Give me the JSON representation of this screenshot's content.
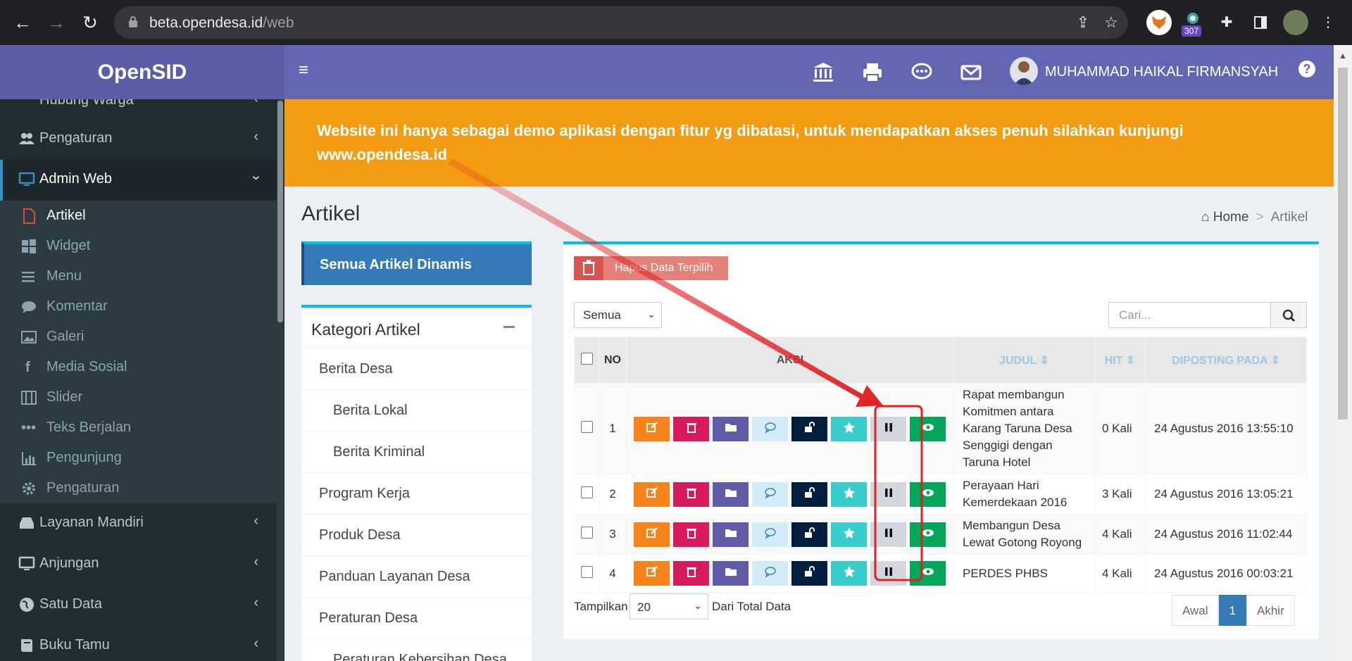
{
  "browser": {
    "url_host": "beta.opendesa.id",
    "url_path": "/web",
    "ext_badge": "307"
  },
  "app": {
    "logo": "OpenSID",
    "user_name": "MUHAMMAD HAIKAL FIRMANSYAH",
    "help": "?"
  },
  "sidebar": {
    "items": [
      {
        "label": "Hubung Warga",
        "icon": "comments-icon"
      },
      {
        "label": "Pengaturan",
        "icon": "users-icon"
      },
      {
        "label": "Admin Web",
        "icon": "monitor-icon"
      },
      {
        "label": "Layanan Mandiri",
        "icon": "inbox-icon"
      },
      {
        "label": "Anjungan",
        "icon": "monitor-icon"
      },
      {
        "label": "Satu Data",
        "icon": "globe-icon"
      },
      {
        "label": "Buku Tamu",
        "icon": "book-icon"
      }
    ],
    "sub_items": [
      {
        "label": "Artikel",
        "icon": "file-icon"
      },
      {
        "label": "Widget",
        "icon": "windows-icon"
      },
      {
        "label": "Menu",
        "icon": "bars-icon"
      },
      {
        "label": "Komentar",
        "icon": "comments-icon"
      },
      {
        "label": "Galeri",
        "icon": "image-icon"
      },
      {
        "label": "Media Sosial",
        "icon": "facebook-icon"
      },
      {
        "label": "Slider",
        "icon": "film-icon"
      },
      {
        "label": "Teks Berjalan",
        "icon": "ellipsis-icon"
      },
      {
        "label": "Pengunjung",
        "icon": "bar-chart-icon"
      },
      {
        "label": "Pengaturan",
        "icon": "gear-icon"
      }
    ]
  },
  "banner": {
    "line1": "Website ini hanya sebagai demo aplikasi dengan fitur yg dibatasi, untuk mendapatkan akses penuh silahkan kunjungi",
    "line2": "www.opendesa.id"
  },
  "page": {
    "title": "Artikel",
    "breadcrumb_home": "Home",
    "breadcrumb_sep": ">",
    "breadcrumb_current": "Artikel"
  },
  "left_panel": {
    "all_button": "Semua Artikel Dinamis",
    "category_title": "Kategori Artikel",
    "categories": [
      {
        "label": "Berita Desa",
        "indent": false
      },
      {
        "label": "Berita Lokal",
        "indent": true
      },
      {
        "label": "Berita Kriminal",
        "indent": true
      },
      {
        "label": "Program Kerja",
        "indent": false
      },
      {
        "label": "Produk Desa",
        "indent": false
      },
      {
        "label": "Panduan Layanan Desa",
        "indent": false
      },
      {
        "label": "Peraturan Desa",
        "indent": false
      },
      {
        "label": "Peraturan Kebersihan Desa",
        "indent": true
      }
    ]
  },
  "table_box": {
    "delete_button": "Hapus Data Terpilih",
    "filter_value": "Semua",
    "search_placeholder": "Cari...",
    "headers": {
      "no": "NO",
      "aksi": "AKSI",
      "judul": "JUDUL",
      "hit": "HIT",
      "diposting": "DIPOSTING PADA"
    },
    "rows": [
      {
        "no": "1",
        "judul": "Rapat membangun Komitmen antara Karang Taruna Desa Senggigi dengan Taruna Hotel",
        "hit": "0 Kali",
        "date": "24 Agustus 2016 13:55:10"
      },
      {
        "no": "2",
        "judul": "Perayaan Hari Kemerdekaan 2016",
        "hit": "3 Kali",
        "date": "24 Agustus 2016 13:05:21"
      },
      {
        "no": "3",
        "judul": "Membangun Desa Lewat Gotong Royong",
        "hit": "4 Kali",
        "date": "24 Agustus 2016 11:02:44"
      },
      {
        "no": "4",
        "judul": "PERDES PHBS",
        "hit": "4 Kali",
        "date": "24 Agustus 2016 00:03:21"
      }
    ],
    "action_buttons": [
      {
        "name": "edit-icon",
        "color": "#f7841b"
      },
      {
        "name": "trash-icon",
        "color": "#d81b60"
      },
      {
        "name": "folder-icon",
        "color": "#605ca8"
      },
      {
        "name": "comment-icon",
        "color": "#d3ecf8"
      },
      {
        "name": "unlock-icon",
        "color": "#001f3f"
      },
      {
        "name": "star-icon",
        "color": "#39cccc"
      },
      {
        "name": "pause-icon",
        "color": "#d2d6de"
      },
      {
        "name": "eye-icon",
        "color": "#00a65a"
      }
    ],
    "show_label": "Tampilkan",
    "show_value": "20",
    "total_label": "Dari Total Data",
    "pager": {
      "first": "Awal",
      "current": "1",
      "last": "Akhir"
    }
  },
  "colors": {
    "header": "#6366b3",
    "sidebar": "#222d32",
    "banner": "#f39c12",
    "accent": "#00c0ef",
    "annotation": "#e02020"
  }
}
